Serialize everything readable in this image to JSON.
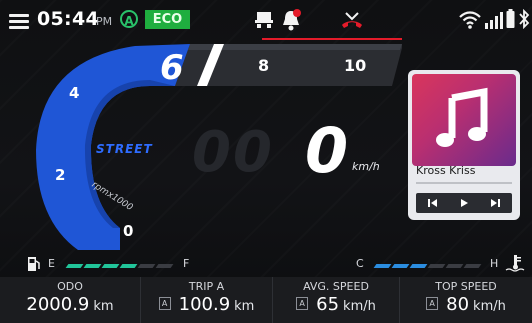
{
  "status": {
    "time": "05:44",
    "ampm": "PM",
    "mode_letter": "A",
    "eco_label": "ECO",
    "icons": [
      "menu-icon",
      "mode-a-icon",
      "eco-badge",
      "bike-icon",
      "bell-alert-icon",
      "call-missed-icon",
      "wifi-icon",
      "signal-icon",
      "battery-icon",
      "bluetooth-icon"
    ]
  },
  "tacho": {
    "gear": "6",
    "ticks": [
      "0",
      "2",
      "4",
      "8",
      "10"
    ],
    "mode_label": "STREET",
    "unit_label": "rpmx1000",
    "level_fraction": 0.6
  },
  "speed": {
    "ghost_digits": "00",
    "value": "0",
    "unit": "km/h"
  },
  "music": {
    "track": "Kross Kriss",
    "progress_fraction": 0.0,
    "icon": "music-note-icon",
    "controls": [
      "previous-icon",
      "play-icon",
      "next-icon"
    ]
  },
  "fuel": {
    "empty_label": "E",
    "full_label": "F",
    "level_fraction": 0.6,
    "color": "#21c59a",
    "icon": "fuel-pump-icon"
  },
  "temp": {
    "cold_label": "C",
    "hot_label": "H",
    "level_fraction": 0.5,
    "color": "#2b8de0",
    "icon": "coolant-temp-icon"
  },
  "bottom": [
    {
      "title": "ODO",
      "badge": "",
      "value": "2000.9",
      "unit": "km"
    },
    {
      "title": "TRIP A",
      "badge": "A",
      "value": "100.9",
      "unit": "km"
    },
    {
      "title": "AVG. SPEED",
      "badge": "A",
      "value": "65",
      "unit": "km/h"
    },
    {
      "title": "TOP SPEED",
      "badge": "A",
      "value": "80",
      "unit": "km/h"
    }
  ],
  "colors": {
    "accent_blue": "#1f56d6",
    "eco_green": "#1fae3f",
    "alert_red": "#e41b2a"
  }
}
